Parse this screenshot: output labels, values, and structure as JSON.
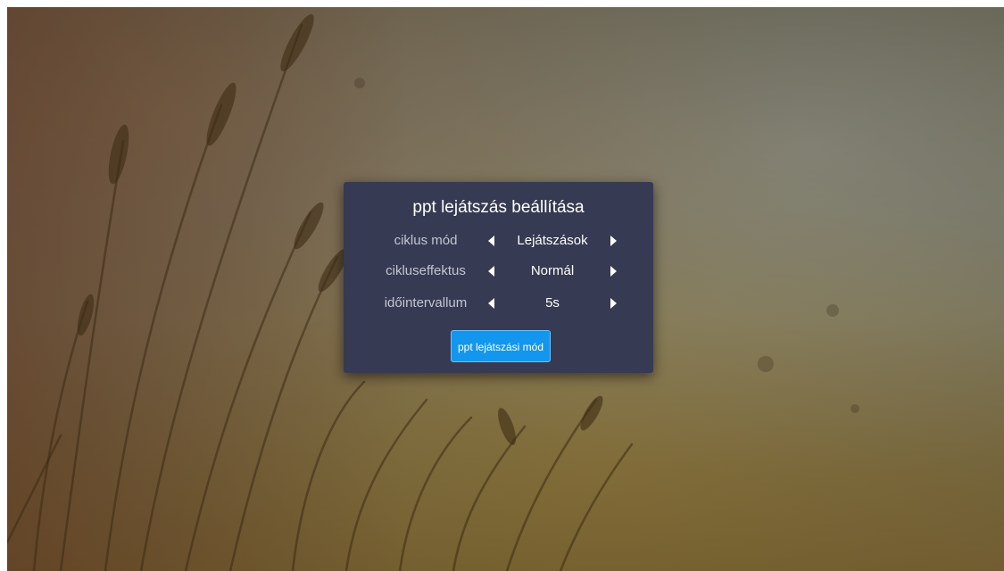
{
  "dialog": {
    "title": "ppt lejátszás beállítása",
    "settings": [
      {
        "label": "ciklus mód",
        "value": "Lejátszások"
      },
      {
        "label": "cikluseffektus",
        "value": "Normál"
      },
      {
        "label": "időintervallum",
        "value": "5s"
      }
    ],
    "button_label": "ppt lejátszási mód"
  },
  "colors": {
    "dialog_background": "#363a52",
    "button_background": "#1296ee",
    "label_text": "#c4c6d2",
    "value_text": "#ffffff"
  },
  "icons": {
    "previous": "triangle-left-icon",
    "next": "triangle-right-icon"
  }
}
